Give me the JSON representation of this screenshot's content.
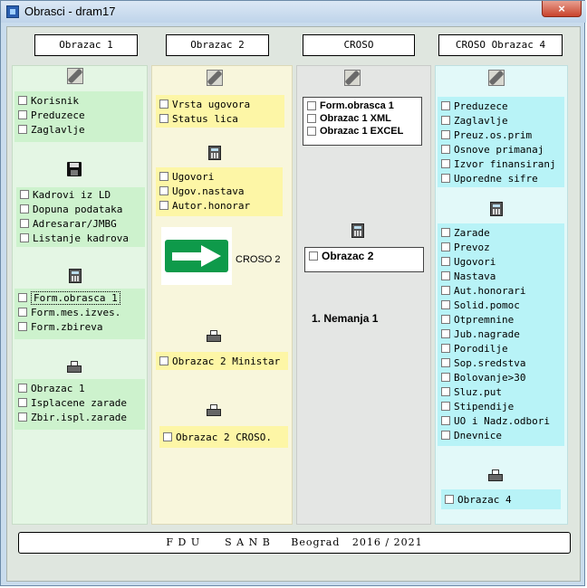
{
  "window": {
    "title": "Obrasci - dram17",
    "close_label": "×"
  },
  "headers": [
    "Obrazac 1",
    "Obrazac 2",
    "CROSO",
    "CROSO Obrazac 4"
  ],
  "col1": {
    "settings": [
      "Korisnik",
      "Preduzece",
      "Zaglavlje"
    ],
    "hr": [
      "Kadrovi iz LD",
      "Dopuna podataka",
      "Adresarar/JMBG",
      "Listanje kadrova"
    ],
    "forms": [
      "Form.obrasca 1",
      "Form.mes.izves.",
      "Form.zbireva"
    ],
    "print": [
      "Obrazac 1",
      "Isplacene zarade",
      "Zbir.ispl.zarade"
    ]
  },
  "col2": {
    "settings": [
      "Vrsta ugovora",
      "Status lica"
    ],
    "contracts": [
      "Ugovori",
      "Ugov.nastava",
      "Autor.honorar"
    ],
    "croso_label": "CROSO 2",
    "print1": "Obrazac 2 Ministar",
    "print2": "Obrazac 2 CROSO."
  },
  "col3": {
    "forms": [
      "Form.obrasca 1",
      "Obrazac 1 XML",
      "Obrazac 1 EXCEL"
    ],
    "obrazac2": "Obrazac 2",
    "note": "1. Nemanja 1"
  },
  "col4": {
    "settings": [
      "Preduzece",
      "Zaglavlje",
      "Preuz.os.prim",
      "Osnove primanaj",
      "Izvor finansiranj",
      "Uporedne sifre"
    ],
    "items": [
      "Zarade",
      "Prevoz",
      "Ugovori",
      "Nastava",
      "Aut.honorari",
      "Solid.pomoc",
      "Otpremnine",
      "Jub.nagrade",
      "Porodilje",
      "Sop.sredstva",
      "Bolovanje>30",
      "Sluz.put",
      "Stipendije",
      "UO i Nadz.odbori",
      "Dnevnice"
    ],
    "print": "Obrazac 4"
  },
  "footer": "F D U      S A N B     Beograd   2016 / 2021"
}
